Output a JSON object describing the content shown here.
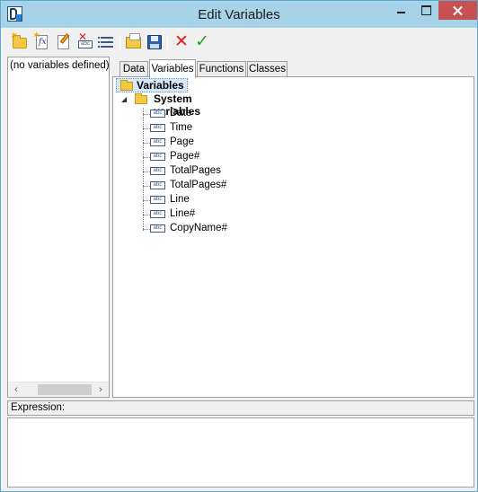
{
  "window": {
    "title": "Edit Variables",
    "app_icon": "fastreport-icon"
  },
  "toolbar": {
    "buttons": [
      {
        "name": "new-category-button",
        "icon": "new-folder-icon"
      },
      {
        "name": "new-variable-button",
        "icon": "new-fx-icon"
      },
      {
        "name": "edit-button",
        "icon": "edit-icon"
      },
      {
        "name": "delete-button",
        "icon": "delete-icon"
      },
      {
        "name": "list-button",
        "icon": "list-icon"
      },
      {
        "name": "open-button",
        "icon": "open-icon"
      },
      {
        "name": "save-button",
        "icon": "save-icon"
      },
      {
        "name": "cancel-button",
        "icon": "cancel-icon"
      },
      {
        "name": "ok-button",
        "icon": "ok-icon"
      }
    ]
  },
  "left_panel": {
    "empty_text": "(no variables defined)"
  },
  "tabs": [
    "Data",
    "Variables",
    "Functions",
    "Classes"
  ],
  "active_tab": "Variables",
  "tree": {
    "root": "Variables",
    "group": "System variables",
    "items": [
      "Date",
      "Time",
      "Page",
      "Page#",
      "TotalPages",
      "TotalPages#",
      "Line",
      "Line#",
      "CopyName#"
    ]
  },
  "expression": {
    "label": "Expression:",
    "value": ""
  },
  "colors": {
    "titlebar": "#a7d3e9",
    "close_button": "#c75050",
    "selection": "#d6e8f7"
  }
}
